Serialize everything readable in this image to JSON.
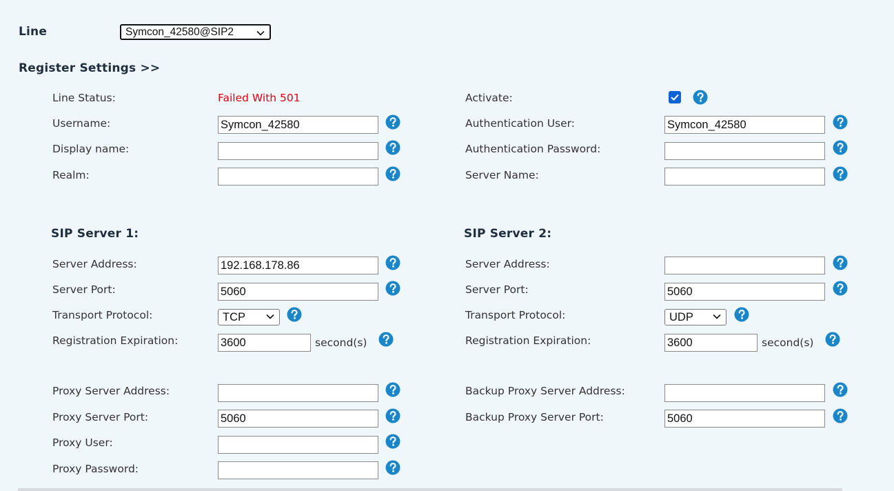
{
  "line": {
    "label": "Line",
    "selected": "Symcon_42580@SIP2"
  },
  "register": {
    "title": "Register Settings >>",
    "line_status_label": "Line Status:",
    "line_status_value": "Failed With 501",
    "activate_label": "Activate:",
    "activate_checked": true,
    "username_label": "Username:",
    "username_value": "Symcon_42580",
    "auth_user_label": "Authentication User:",
    "auth_user_value": "Symcon_42580",
    "display_name_label": "Display name:",
    "display_name_value": "",
    "auth_password_label": "Authentication Password:",
    "auth_password_value": "",
    "realm_label": "Realm:",
    "realm_value": "",
    "server_name_label": "Server Name:",
    "server_name_value": ""
  },
  "sip1": {
    "title": "SIP Server 1:",
    "address_label": "Server Address:",
    "address_value": "192.168.178.86",
    "port_label": "Server Port:",
    "port_value": "5060",
    "transport_label": "Transport Protocol:",
    "transport_value": "TCP",
    "expiration_label": "Registration Expiration:",
    "expiration_value": "3600",
    "expiration_unit": "second(s)"
  },
  "sip2": {
    "title": "SIP Server 2:",
    "address_label": "Server Address:",
    "address_value": "",
    "port_label": "Server Port:",
    "port_value": "5060",
    "transport_label": "Transport Protocol:",
    "transport_value": "UDP",
    "expiration_label": "Registration Expiration:",
    "expiration_value": "3600",
    "expiration_unit": "second(s)"
  },
  "proxy": {
    "address_label": "Proxy Server Address:",
    "address_value": "",
    "port_label": "Proxy Server Port:",
    "port_value": "5060",
    "user_label": "Proxy User:",
    "user_value": "",
    "password_label": "Proxy Password:",
    "password_value": "",
    "backup_address_label": "Backup Proxy Server Address:",
    "backup_address_value": "",
    "backup_port_label": "Backup Proxy Server Port:",
    "backup_port_value": "5060"
  },
  "colors": {
    "background": "#f0f7fb",
    "help_icon": "#1a86c8",
    "status_error": "#e3000f",
    "checkbox": "#0b63d6"
  },
  "icons": {
    "help": "help-circle-icon",
    "chevron": "chevron-down-icon",
    "check": "check-icon"
  }
}
